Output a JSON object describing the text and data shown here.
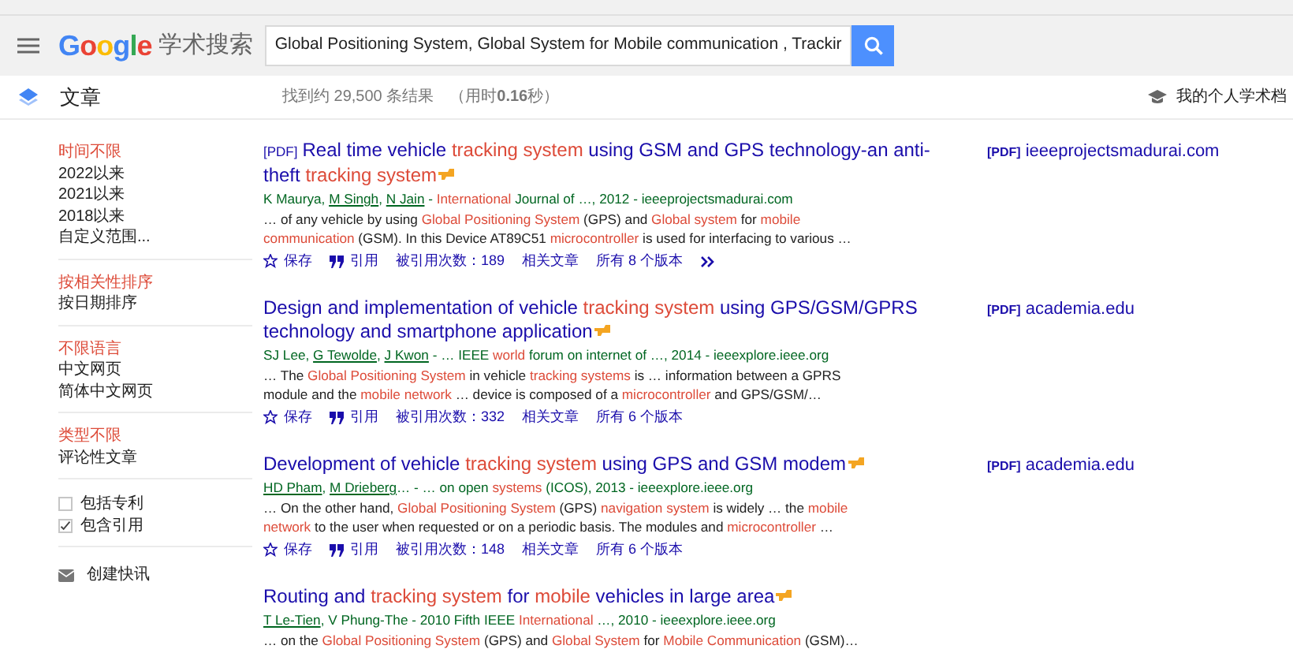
{
  "header": {
    "logo": "Google",
    "logo_suffix": "学术搜索",
    "search_value": "Global Positioning System, Global System for Mobile communication , Trackir"
  },
  "subbar": {
    "section": "文章",
    "result_count": "找到约 29,500 条结果",
    "time_prefix": "（用时",
    "time_value": "0.16",
    "time_suffix": "秒）",
    "profile_link": "我的个人学术档"
  },
  "sidebar": {
    "groups": [
      {
        "items": [
          {
            "label": "时间不限",
            "selected": true
          },
          {
            "label": "2022以来",
            "selected": false
          },
          {
            "label": "2021以来",
            "selected": false
          },
          {
            "label": "2018以来",
            "selected": false
          },
          {
            "label": "自定义范围...",
            "selected": false
          }
        ]
      },
      {
        "items": [
          {
            "label": "按相关性排序",
            "selected": true
          },
          {
            "label": "按日期排序",
            "selected": false
          }
        ]
      },
      {
        "items": [
          {
            "label": "不限语言",
            "selected": true
          },
          {
            "label": "中文网页",
            "selected": false
          },
          {
            "label": "简体中文网页",
            "selected": false
          }
        ]
      },
      {
        "items": [
          {
            "label": "类型不限",
            "selected": true
          },
          {
            "label": "评论性文章",
            "selected": false
          }
        ]
      }
    ],
    "checkboxes": [
      {
        "label": "包括专利",
        "checked": false
      },
      {
        "label": "包含引用",
        "checked": true
      }
    ],
    "alert": "创建快讯"
  },
  "results": [
    {
      "tag": "[PDF]",
      "title": [
        {
          "t": "Real time vehicle ",
          "h": false
        },
        {
          "t": "tracking system",
          "h": true
        },
        {
          "t": " using GSM and GPS technology-an anti-theft ",
          "h": false
        },
        {
          "t": "tracking system",
          "h": true
        }
      ],
      "authors": [
        {
          "t": "K Maurya, ",
          "h": false,
          "link": false
        },
        {
          "t": "M Singh",
          "h": false,
          "link": true
        },
        {
          "t": ", ",
          "h": false,
          "link": false
        },
        {
          "t": "N Jain",
          "h": false,
          "link": true
        },
        {
          "t": " - ",
          "h": false,
          "link": false
        },
        {
          "t": "International",
          "h": true,
          "link": false
        },
        {
          "t": " Journal of …, 2012 - ieeeprojectsmadurai.com",
          "h": false,
          "link": false
        }
      ],
      "snippet": [
        {
          "t": "… of any vehicle by using ",
          "h": false
        },
        {
          "t": "Global Positioning System",
          "h": true
        },
        {
          "t": " (GPS) and ",
          "h": false
        },
        {
          "t": "Global system",
          "h": true
        },
        {
          "t": " for ",
          "h": false
        },
        {
          "t": "mobile communication",
          "h": true
        },
        {
          "t": " (GSM). In this Device AT89C51 ",
          "h": false
        },
        {
          "t": "microcontroller",
          "h": true
        },
        {
          "t": " is used for interfacing to various …",
          "h": false
        }
      ],
      "actions": [
        {
          "kind": "save",
          "label": "保存"
        },
        {
          "kind": "cite",
          "label": "引用"
        },
        {
          "kind": "link",
          "label": "被引用次数：189"
        },
        {
          "kind": "link",
          "label": "相关文章"
        },
        {
          "kind": "link",
          "label": "所有 8 个版本"
        },
        {
          "kind": "more"
        }
      ],
      "side": {
        "tag": "[PDF]",
        "domain": "ieeeprojectsmadurai.com"
      }
    },
    {
      "title": [
        {
          "t": "Design and implementation of vehicle ",
          "h": false
        },
        {
          "t": "tracking system",
          "h": true
        },
        {
          "t": " using GPS/GSM/GPRS technology and smartphone application",
          "h": false
        }
      ],
      "authors": [
        {
          "t": "SJ Lee, ",
          "h": false,
          "link": false
        },
        {
          "t": "G Tewolde",
          "h": false,
          "link": true
        },
        {
          "t": ", ",
          "h": false,
          "link": false
        },
        {
          "t": "J Kwon",
          "h": false,
          "link": true
        },
        {
          "t": " - … IEEE ",
          "h": false,
          "link": false
        },
        {
          "t": "world",
          "h": true,
          "link": false
        },
        {
          "t": " forum on internet of …, 2014 - ieeexplore.ieee.org",
          "h": false,
          "link": false
        }
      ],
      "snippet": [
        {
          "t": "… The ",
          "h": false
        },
        {
          "t": "Global Positioning System",
          "h": true
        },
        {
          "t": " in vehicle ",
          "h": false
        },
        {
          "t": "tracking systems",
          "h": true
        },
        {
          "t": " is … information between a GPRS module and the ",
          "h": false
        },
        {
          "t": "mobile network",
          "h": true
        },
        {
          "t": " … device is composed of a ",
          "h": false
        },
        {
          "t": "microcontroller",
          "h": true
        },
        {
          "t": " and GPS/GSM/…",
          "h": false
        }
      ],
      "actions": [
        {
          "kind": "save",
          "label": "保存"
        },
        {
          "kind": "cite",
          "label": "引用"
        },
        {
          "kind": "link",
          "label": "被引用次数：332"
        },
        {
          "kind": "link",
          "label": "相关文章"
        },
        {
          "kind": "link",
          "label": "所有 6 个版本"
        }
      ],
      "side": {
        "tag": "[PDF]",
        "domain": "academia.edu"
      }
    },
    {
      "title": [
        {
          "t": "Development of vehicle ",
          "h": false
        },
        {
          "t": "tracking system",
          "h": true
        },
        {
          "t": " using GPS and GSM modem",
          "h": false
        }
      ],
      "authors": [
        {
          "t": "HD Pham",
          "h": false,
          "link": true
        },
        {
          "t": ", ",
          "h": false,
          "link": false
        },
        {
          "t": "M Drieberg",
          "h": false,
          "link": true
        },
        {
          "t": "… - … on open ",
          "h": false,
          "link": false
        },
        {
          "t": "systems",
          "h": true,
          "link": false
        },
        {
          "t": " (ICOS), 2013 - ieeexplore.ieee.org",
          "h": false,
          "link": false
        }
      ],
      "snippet": [
        {
          "t": "… On the other hand, ",
          "h": false
        },
        {
          "t": "Global Positioning System",
          "h": true
        },
        {
          "t": " (GPS) ",
          "h": false
        },
        {
          "t": "navigation system",
          "h": true
        },
        {
          "t": " is widely … the ",
          "h": false
        },
        {
          "t": "mobile network",
          "h": true
        },
        {
          "t": " to the user when requested or on a periodic basis. The modules and ",
          "h": false
        },
        {
          "t": "microcontroller",
          "h": true
        },
        {
          "t": " …",
          "h": false
        }
      ],
      "actions": [
        {
          "kind": "save",
          "label": "保存"
        },
        {
          "kind": "cite",
          "label": "引用"
        },
        {
          "kind": "link",
          "label": "被引用次数：148"
        },
        {
          "kind": "link",
          "label": "相关文章"
        },
        {
          "kind": "link",
          "label": "所有 6 个版本"
        }
      ],
      "side": {
        "tag": "[PDF]",
        "domain": "academia.edu"
      }
    },
    {
      "title": [
        {
          "t": "Routing and ",
          "h": false
        },
        {
          "t": "tracking system",
          "h": true
        },
        {
          "t": " for ",
          "h": false
        },
        {
          "t": "mobile",
          "h": true
        },
        {
          "t": " vehicles in large area",
          "h": false
        }
      ],
      "authors": [
        {
          "t": "T Le-Tien",
          "h": false,
          "link": true
        },
        {
          "t": ", V Phung-The - 2010 Fifth IEEE ",
          "h": false,
          "link": false
        },
        {
          "t": "International",
          "h": true,
          "link": false
        },
        {
          "t": " …, 2010 - ieeexplore.ieee.org",
          "h": false,
          "link": false
        }
      ],
      "snippet": [
        {
          "t": "… on the ",
          "h": false
        },
        {
          "t": "Global Positioning System",
          "h": true
        },
        {
          "t": " (GPS) and ",
          "h": false
        },
        {
          "t": "Global System",
          "h": true
        },
        {
          "t": " for ",
          "h": false
        },
        {
          "t": "Mobile Communication",
          "h": true
        },
        {
          "t": " (GSM)…",
          "h": false
        }
      ]
    }
  ]
}
